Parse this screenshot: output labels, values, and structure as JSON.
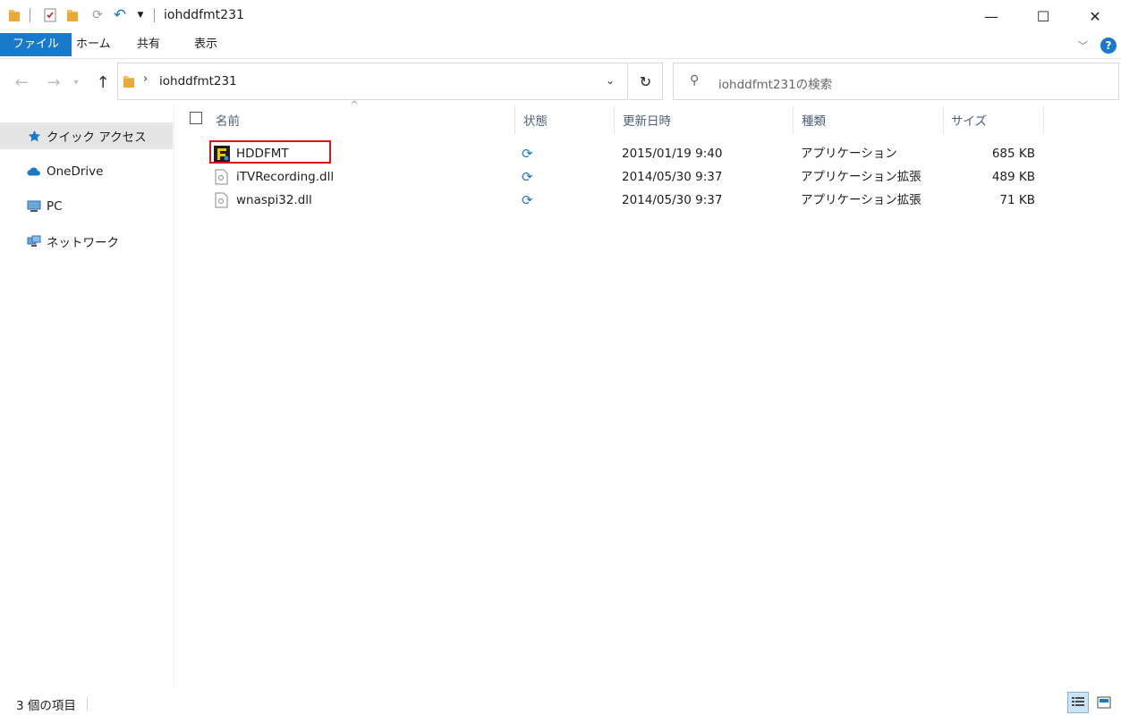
{
  "window": {
    "title": "iohddfmt231",
    "minimize": "—",
    "maximize": "☐",
    "close": "✕"
  },
  "ribbon": {
    "tabs": [
      {
        "label": "ファイル"
      },
      {
        "label": "ホーム"
      },
      {
        "label": "共有"
      },
      {
        "label": "表示"
      }
    ],
    "help": "?"
  },
  "address": {
    "path": "iohddfmt231",
    "search_placeholder": "iohddfmt231の検索"
  },
  "sidebar": {
    "items": [
      {
        "label": "クイック アクセス",
        "icon": "star-icon"
      },
      {
        "label": "OneDrive",
        "icon": "cloud-icon"
      },
      {
        "label": "PC",
        "icon": "pc-icon"
      },
      {
        "label": "ネットワーク",
        "icon": "network-icon"
      }
    ]
  },
  "columns": {
    "name": "名前",
    "status": "状態",
    "modified": "更新日時",
    "type": "種類",
    "size": "サイズ"
  },
  "files": [
    {
      "name": "HDDFMT",
      "modified": "2015/01/19 9:40",
      "type": "アプリケーション",
      "size": "685 KB",
      "icon": "hddfmt-app-icon",
      "highlighted": true
    },
    {
      "name": "iTVRecording.dll",
      "modified": "2014/05/30 9:37",
      "type": "アプリケーション拡張",
      "size": "489 KB",
      "icon": "dll-file-icon"
    },
    {
      "name": "wnaspi32.dll",
      "modified": "2014/05/30 9:37",
      "type": "アプリケーション拡張",
      "size": "71 KB",
      "icon": "dll-file-icon"
    }
  ],
  "status": {
    "item_count": "3 個の項目"
  },
  "colors": {
    "accent": "#1979ca",
    "highlight_border": "#d9151c",
    "header_text": "#4c607a"
  }
}
